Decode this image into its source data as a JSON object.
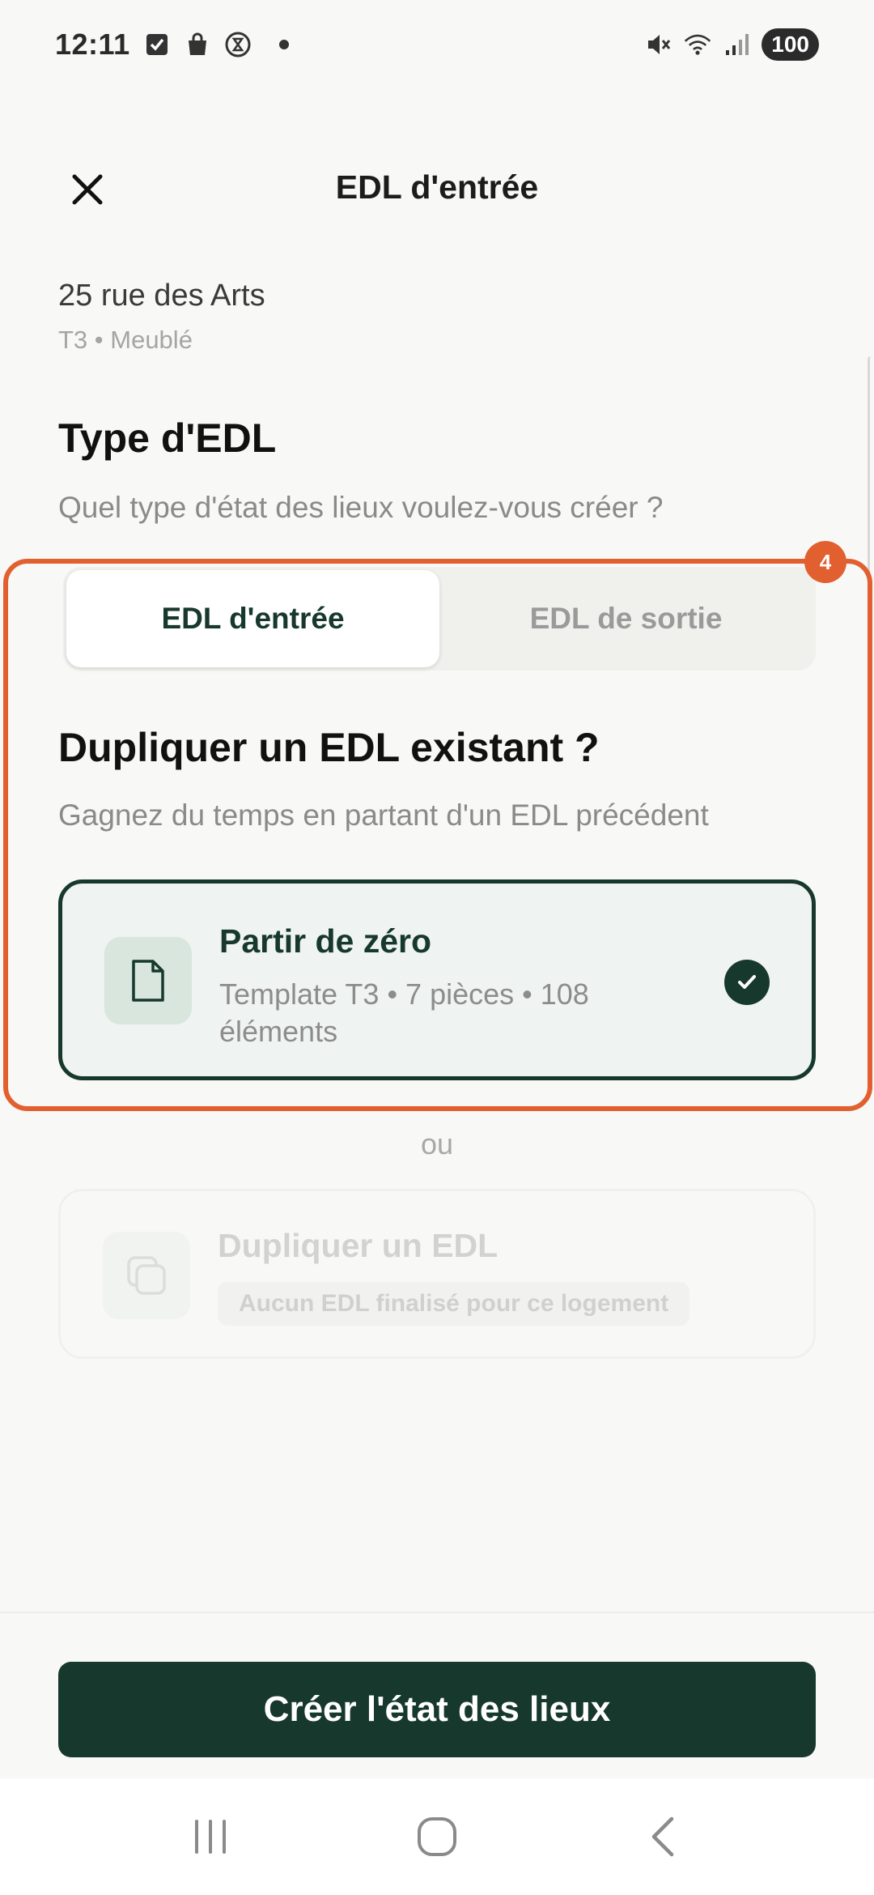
{
  "status_bar": {
    "time": "12:11",
    "battery": "100",
    "icons": [
      "checkbox-icon",
      "shopping-bag-icon",
      "timer-icon",
      "dot-icon",
      "mute-icon",
      "wifi-icon",
      "signal-icon"
    ]
  },
  "header": {
    "title": "EDL d'entrée",
    "close_icon": "close-icon"
  },
  "property": {
    "address": "25 rue des Arts",
    "details": "T3 • Meublé"
  },
  "type_section": {
    "title": "Type d'EDL",
    "subtitle": "Quel type d'état des lieux voulez-vous créer ?",
    "options": [
      {
        "label": "EDL d'entrée",
        "selected": true
      },
      {
        "label": "EDL de sortie",
        "selected": false
      }
    ]
  },
  "duplicate_section": {
    "title": "Dupliquer un EDL existant ?",
    "subtitle": "Gagnez du temps en partant d'un EDL précédent",
    "from_scratch": {
      "title": "Partir de zéro",
      "description": "Template T3 • 7 pièces • 108 éléments",
      "icon": "document-icon",
      "selected": true
    },
    "separator": "ou",
    "duplicate": {
      "title": "Dupliquer un EDL",
      "badge": "Aucun EDL finalisé pour ce logement",
      "icon": "copy-icon",
      "disabled": true
    }
  },
  "annotation": {
    "badge": "4",
    "color": "#e25f2f"
  },
  "cta": {
    "label": "Créer l'état des lieux"
  },
  "colors": {
    "primary": "#17382d",
    "background": "#f8f8f6",
    "highlight": "#e25f2f"
  }
}
